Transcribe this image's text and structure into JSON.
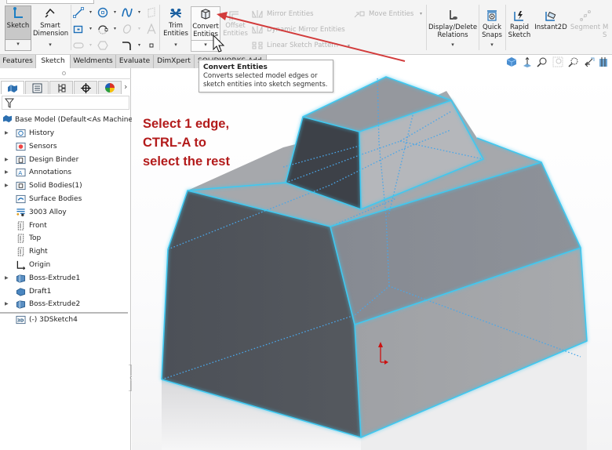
{
  "ribbon": {
    "sketch": {
      "label": "Sketch",
      "icon": "sketch-icon",
      "active": true
    },
    "smart_dimension": {
      "label_line1": "Smart",
      "label_line2": "Dimension",
      "icon": "smart-dimension-icon"
    },
    "small_tools": [
      {
        "name": "line-tool",
        "icon": "line-icon"
      },
      {
        "name": "circle-tool",
        "icon": "circle-icon"
      },
      {
        "name": "spline-tool",
        "icon": "spline-icon"
      },
      {
        "name": "surface-tool",
        "icon": "plane-icon",
        "disabled": true
      },
      {
        "name": "rectangle-tool",
        "icon": "rectangle-icon"
      },
      {
        "name": "arc-tool",
        "icon": "arc-icon"
      },
      {
        "name": "ellipse-tool",
        "icon": "ellipse-icon",
        "disabled": true
      },
      {
        "name": "text-tool",
        "icon": "text-icon",
        "disabled": true
      },
      {
        "name": "slot-tool",
        "icon": "slot-icon",
        "disabled": true
      },
      {
        "name": "polygon-tool",
        "icon": "polygon-icon",
        "disabled": true
      },
      {
        "name": "fillet-tool",
        "icon": "fillet-icon"
      },
      {
        "name": "point-tool",
        "icon": "point-icon"
      }
    ],
    "trim": {
      "label_line1": "Trim",
      "label_line2": "Entities",
      "icon": "trim-icon"
    },
    "convert": {
      "label_line1": "Convert",
      "label_line2": "Entities",
      "icon": "convert-entities-icon"
    },
    "offset": {
      "label_line1": "Offset",
      "label_line2": "Entities",
      "disabled": true
    },
    "mirror": {
      "label": "Mirror Entities",
      "disabled": true
    },
    "dynamic_mirror": {
      "label": "Dynamic Mirror Entities",
      "disabled": true
    },
    "linear_pattern": {
      "label": "Linear Sketch Pattern",
      "disabled": true
    },
    "move": {
      "label": "Move Entities",
      "disabled": true
    },
    "display_delete": {
      "label_line1": "Display/Delete",
      "label_line2": "Relations"
    },
    "quick_snaps": {
      "label_line1": "Quick",
      "label_line2": "Snaps"
    },
    "rapid_sketch": {
      "label_line1": "Rapid",
      "label_line2": "Sketch"
    },
    "instant2d": {
      "label": "Instant2D"
    },
    "segment": {
      "label": "Segment",
      "disabled": true
    },
    "more": {
      "label_line1": "M",
      "label_line2": "S",
      "disabled": true
    }
  },
  "tabs": [
    {
      "label": "Features",
      "active": false
    },
    {
      "label": "Sketch",
      "active": true
    },
    {
      "label": "Weldments",
      "active": false
    },
    {
      "label": "Evaluate",
      "active": false
    },
    {
      "label": "DimXpert",
      "active": false
    },
    {
      "label": "SOLIDWORKS Add-Ins",
      "active": false
    }
  ],
  "view_toolbar": [
    "view-cube-icon",
    "view-normal-icon",
    "zoom-to-fit-icon",
    "zoom-area-icon",
    "zoom-selection-icon",
    "previous-view-icon",
    "section-view-icon"
  ],
  "tooltip": {
    "title": "Convert Entities",
    "description_line1": "Converts selected model edges or",
    "description_line2": "sketch entities into sketch segments."
  },
  "panel": {
    "tabs": [
      "feature-manager-icon",
      "property-manager-icon",
      "configuration-manager-icon",
      "dimxpert-manager-icon",
      "display-manager-icon"
    ],
    "root": "Base Model  (Default<As Machined",
    "tree": [
      {
        "label": "History",
        "expandable": true,
        "icon": "history-folder-icon"
      },
      {
        "label": "Sensors",
        "expandable": false,
        "icon": "sensors-folder-icon"
      },
      {
        "label": "Design Binder",
        "expandable": true,
        "icon": "design-binder-icon"
      },
      {
        "label": "Annotations",
        "expandable": true,
        "icon": "annotations-icon"
      },
      {
        "label": "Solid Bodies(1)",
        "expandable": true,
        "icon": "solid-bodies-icon"
      },
      {
        "label": "Surface Bodies",
        "expandable": false,
        "icon": "surface-bodies-icon"
      },
      {
        "label": "3003 Alloy",
        "expandable": false,
        "icon": "material-icon"
      },
      {
        "label": "Front",
        "expandable": false,
        "icon": "plane-icon"
      },
      {
        "label": "Top",
        "expandable": false,
        "icon": "plane-icon"
      },
      {
        "label": "Right",
        "expandable": false,
        "icon": "plane-icon"
      },
      {
        "label": "Origin",
        "expandable": false,
        "icon": "origin-icon"
      },
      {
        "label": "Boss-Extrude1",
        "expandable": true,
        "icon": "extrude-icon"
      },
      {
        "label": "Draft1",
        "expandable": false,
        "icon": "draft-icon"
      },
      {
        "label": "Boss-Extrude2",
        "expandable": true,
        "icon": "extrude-icon"
      },
      {
        "label": "(-) 3DSketch4",
        "expandable": false,
        "icon": "3d-sketch-icon"
      }
    ]
  },
  "annotation": {
    "line1": "Select 1 edge,",
    "line2": "CTRL-A to",
    "line3": "select the rest",
    "color": "#b31b1b"
  },
  "colors": {
    "selection_edge": "#3fc8f0",
    "hidden_edge": "#4aa6e8",
    "arrow": "#d23b3b",
    "origin": "#cc1111"
  }
}
